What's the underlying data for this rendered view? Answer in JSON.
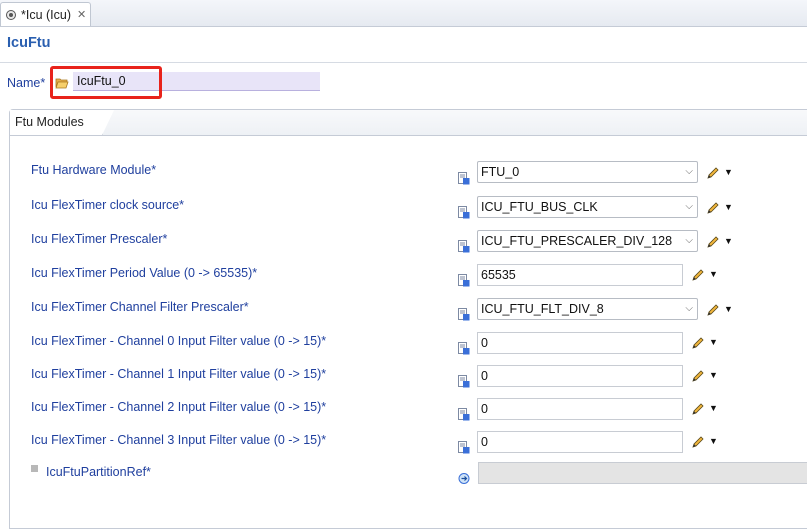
{
  "tab": {
    "title": "*Icu (Icu)",
    "close": "✕"
  },
  "editor": {
    "title": "IcuFtu"
  },
  "name_field": {
    "label": "Name*",
    "value": "IcuFtu_0"
  },
  "panel": {
    "tab_label": "Ftu Modules"
  },
  "rows": [
    {
      "label": "Ftu Hardware Module*",
      "kind": "select",
      "value": "FTU_0"
    },
    {
      "label": "Icu FlexTimer clock source*",
      "kind": "select",
      "value": "ICU_FTU_BUS_CLK"
    },
    {
      "label": "Icu FlexTimer Prescaler*",
      "kind": "select",
      "value": "ICU_FTU_PRESCALER_DIV_128"
    },
    {
      "label": "Icu FlexTimer Period Value (0 -> 65535)*",
      "kind": "number",
      "value": "65535"
    },
    {
      "label": "Icu FlexTimer Channel Filter Prescaler*",
      "kind": "select",
      "value": "ICU_FTU_FLT_DIV_8"
    },
    {
      "label": "Icu FlexTimer - Channel 0 Input Filter value (0 -> 15)*",
      "kind": "number",
      "value": "0"
    },
    {
      "label": "Icu FlexTimer - Channel 1 Input Filter value (0 -> 15)*",
      "kind": "number",
      "value": "0"
    },
    {
      "label": "Icu FlexTimer - Channel 2 Input Filter value (0 -> 15)*",
      "kind": "number",
      "value": "0"
    },
    {
      "label": "Icu FlexTimer - Channel 3 Input Filter value (0 -> 15)*",
      "kind": "number",
      "value": "0"
    }
  ],
  "partition_ref": {
    "label": "IcuFtuPartitionRef*",
    "value": ""
  },
  "icons": {
    "tab": "config-file-icon",
    "folder": "folder-open-icon",
    "value_param": "parameter-value-icon",
    "edit": "pencil-icon",
    "menu": "dropdown-triangle-icon",
    "reference": "reference-link-icon"
  },
  "colors": {
    "label_blue": "#1f3f9e",
    "title_blue": "#2a5fb0",
    "highlight_red": "#e8231b",
    "name_field_bg": "#e8e4f8"
  }
}
